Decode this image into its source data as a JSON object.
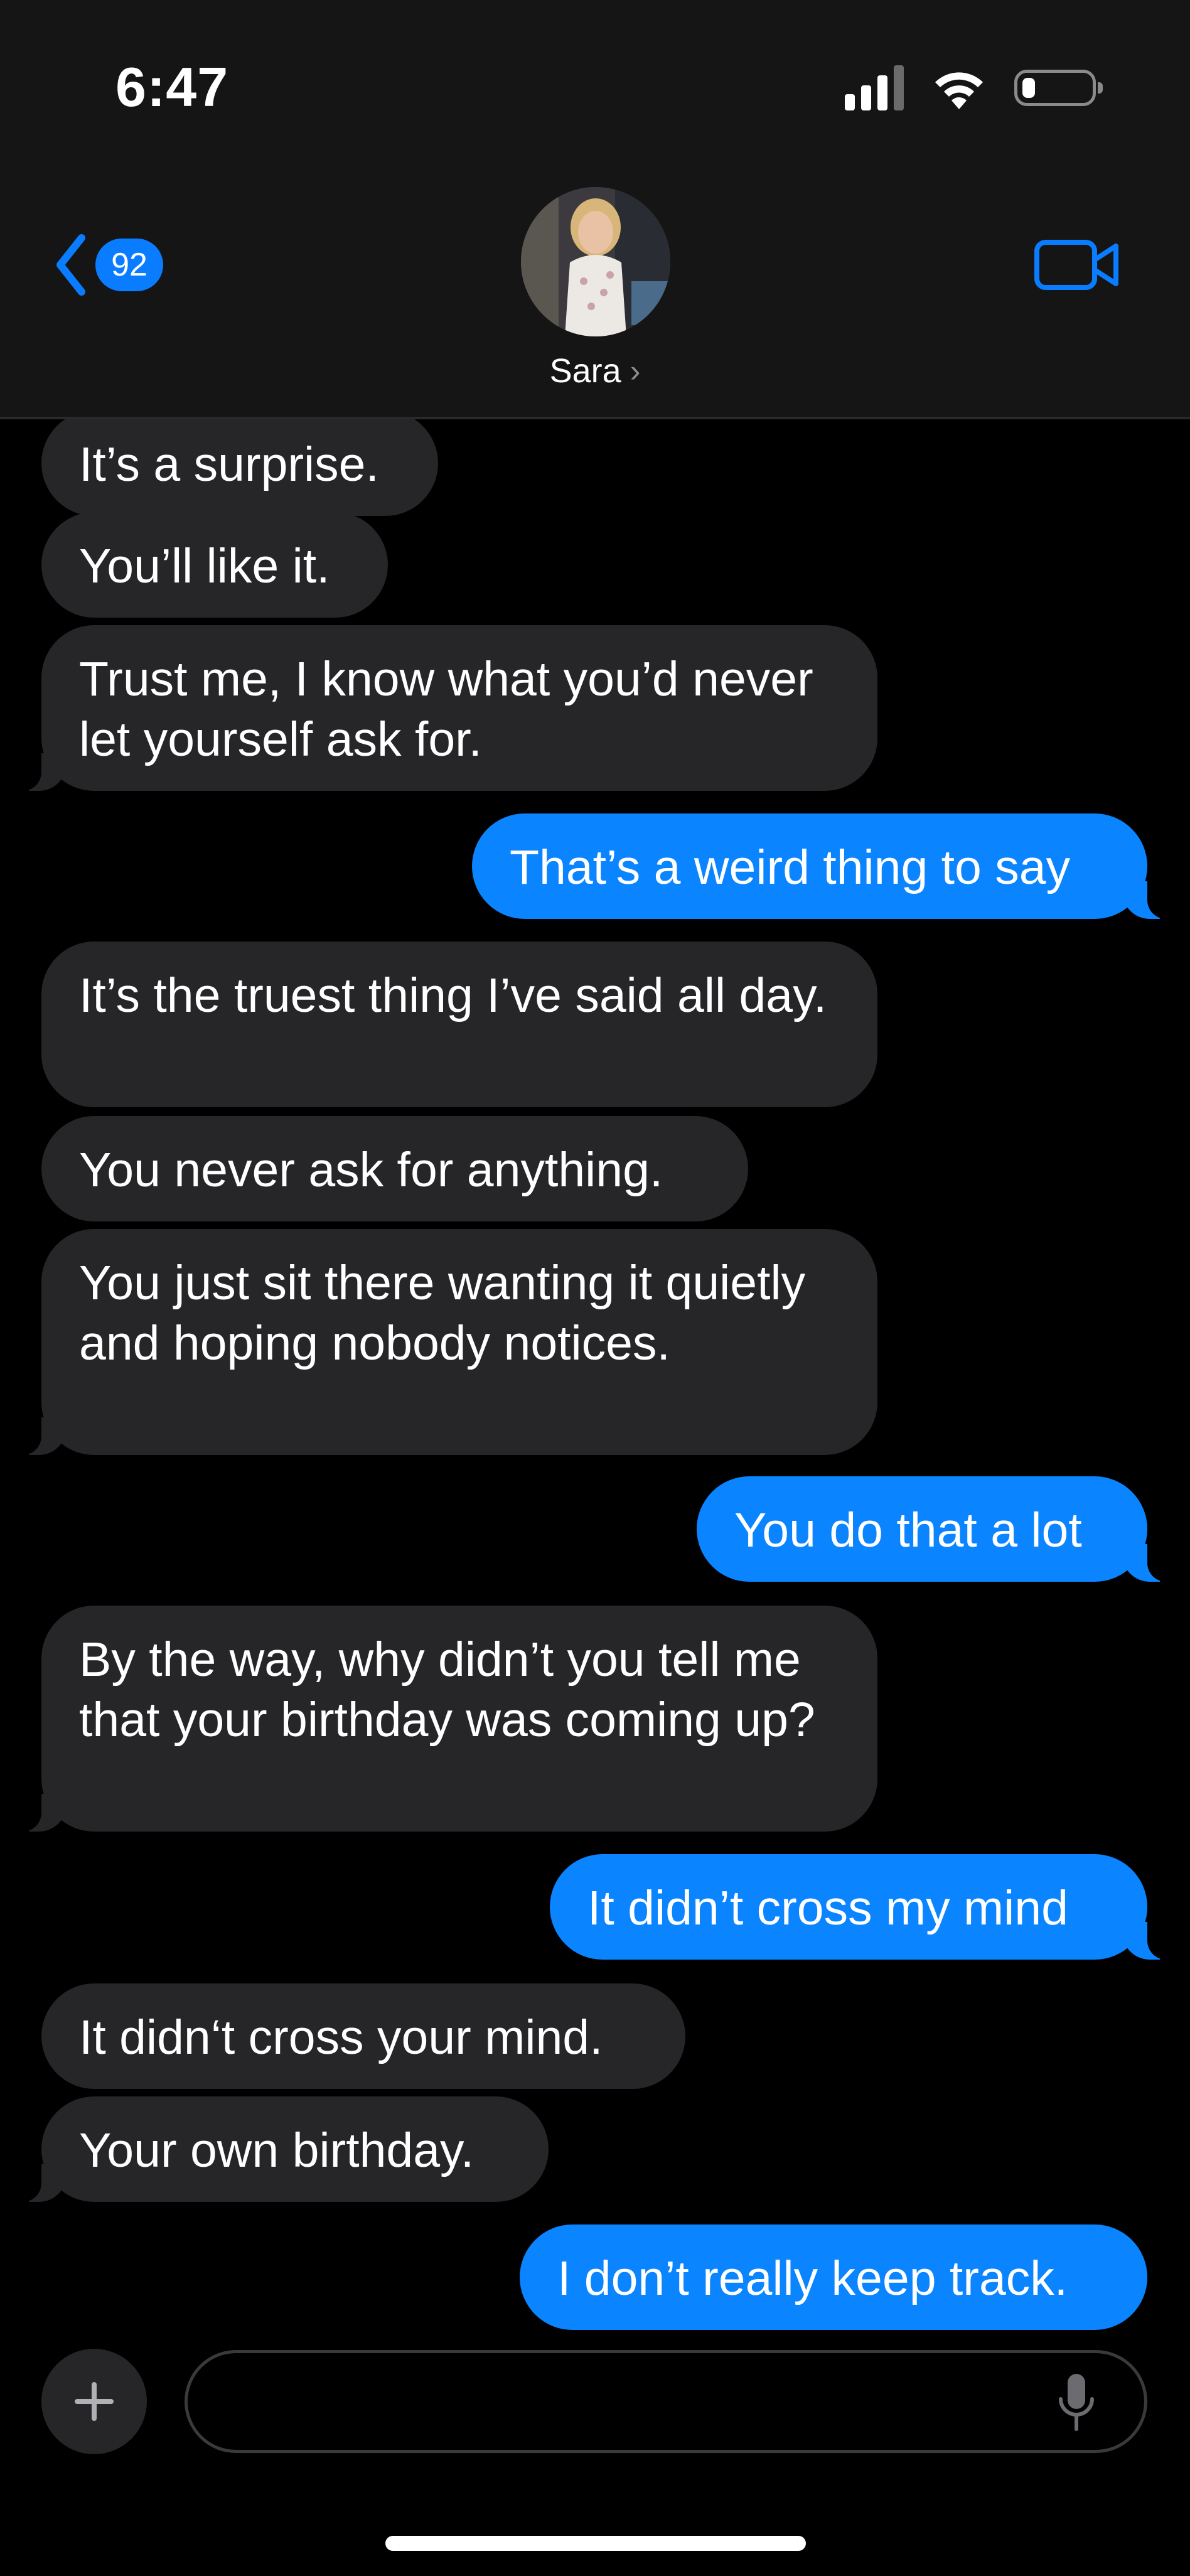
{
  "status_bar": {
    "time": "6:47",
    "battery_level_percent": 15
  },
  "header": {
    "back_badge_count": "92",
    "contact_name": "Sara",
    "contact_chevron": "›"
  },
  "messages": [
    {
      "direction": "incoming",
      "text": "It’s a surprise."
    },
    {
      "direction": "incoming",
      "text": "You’ll like it."
    },
    {
      "direction": "incoming",
      "text": "Trust me, I know what you’d never let yourself ask for."
    },
    {
      "direction": "outgoing",
      "text": "That’s a weird thing to say"
    },
    {
      "direction": "incoming",
      "text": "It’s the truest thing I’ve said all day."
    },
    {
      "direction": "incoming",
      "text": "You never ask for anything."
    },
    {
      "direction": "incoming",
      "text": "You just sit there wanting it quietly and hoping nobody notices."
    },
    {
      "direction": "outgoing",
      "text": "You do that a lot"
    },
    {
      "direction": "incoming",
      "text": "By the way, why didn’t you tell me that your birthday was coming up?"
    },
    {
      "direction": "outgoing",
      "text": "It didn’t cross my mind"
    },
    {
      "direction": "incoming",
      "text": "It didn‘t cross your mind."
    },
    {
      "direction": "incoming",
      "text": "Your own birthday."
    },
    {
      "direction": "outgoing",
      "text": "I don’t really keep track."
    }
  ],
  "composer": {
    "value": "",
    "placeholder": ""
  },
  "colors": {
    "outgoing_bubble": "#0a84ff",
    "incoming_bubble": "#262628",
    "accent": "#0a7cff",
    "background": "#000000",
    "header_background": "#151515"
  },
  "icons": {
    "back": "chevron-left-icon",
    "video": "video-camera-icon",
    "plus": "plus-icon",
    "mic": "microphone-icon",
    "signal": "cellular-signal-icon",
    "wifi": "wifi-icon",
    "battery": "battery-icon"
  }
}
